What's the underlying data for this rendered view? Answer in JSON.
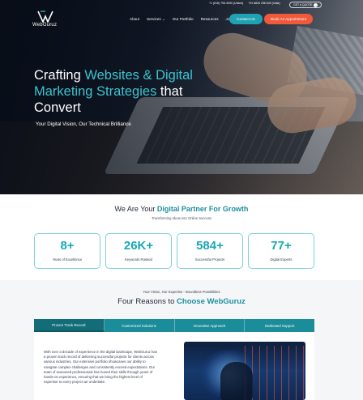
{
  "topbar": {
    "phone_us": "+1 (818) 795-3090 (United)",
    "phone_in": "+91 8826 258 840 (India)",
    "get_quote": "GET A QUOTE"
  },
  "brand": {
    "name": "WebGuruz"
  },
  "nav": {
    "items": [
      "About",
      "Services",
      "Our Portfolio",
      "Resources",
      "Join Us"
    ],
    "contact_label": "Contact Us",
    "appointment_label": "Book An Appointment"
  },
  "hero": {
    "title_part1": "Crafting ",
    "title_accent1": "Websites & Digital Marketing Strategies",
    "title_part2": " that Convert",
    "subtitle": "Your Digital Vision, Our Technical Brilliance"
  },
  "partner": {
    "title_part1": "We Are Your ",
    "title_accent": "Digital Partner For Growth",
    "subtitle": "Transforming Ideas into Online Success",
    "stats": [
      {
        "value": "8+",
        "label": "Years of Excellence"
      },
      {
        "value": "26K+",
        "label": "Keywords Ranked"
      },
      {
        "value": "584+",
        "label": "Successful Projects"
      },
      {
        "value": "77+",
        "label": "Digital Experts"
      }
    ]
  },
  "reasons": {
    "tagline": "Your Vision, Our Expertise - Boundless Possibilities",
    "title_part1": "Four Reasons to ",
    "title_accent": "Choose WebGuruz",
    "tabs": [
      "Proven Track Record",
      "Customized Solutions",
      "Innovative Approach",
      "Dedicated Support"
    ],
    "active_tab": 0,
    "body": "With over a decade of experience in the digital landscape, WebGuruz has a proven track record of delivering successful projects for clients across various industries. Our extensive portfolio showcases our ability to navigate complex challenges and consistently exceed expectations. Our team of seasoned professionals has honed their skills through years of hands-on experience, ensuring that we bring the highest level of expertise to every project we undertake."
  },
  "colors": {
    "accent": "#1d8fa0",
    "cta_orange": "#f05a3a",
    "teal_button": "#1fa3b3"
  }
}
